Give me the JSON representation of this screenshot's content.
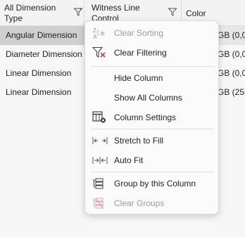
{
  "header": {
    "col1_label": "All Dimension Type",
    "col2_label": "Witness Line Control",
    "col3_label": "Color"
  },
  "rows": [
    {
      "type": "Angular Dimension",
      "color": "GB (0,0,"
    },
    {
      "type": "Diameter Dimension",
      "color": "GB (0,0,"
    },
    {
      "type": "Linear Dimension",
      "color": "GB (0,0,"
    },
    {
      "type": "Linear Dimension",
      "color": "GB (255"
    }
  ],
  "menu": {
    "clear_sorting": "Clear Sorting",
    "clear_filtering": "Clear Filtering",
    "hide_column": "Hide Column",
    "show_all_columns": "Show All Columns",
    "column_settings": "Column Settings",
    "stretch_to_fill": "Stretch to Fill",
    "auto_fit": "Auto Fit",
    "group_by_column": "Group by this Column",
    "clear_groups": "Clear Groups"
  },
  "icons": {
    "clear_sorting": "sort-clear-icon",
    "clear_filtering": "filter-clear-icon",
    "column_settings": "column-settings-icon",
    "stretch_to_fill": "stretch-icon",
    "auto_fit": "autofit-icon",
    "group_by_column": "group-icon",
    "clear_groups": "clear-groups-icon"
  },
  "colors": {
    "accent_red": "#d9363e",
    "selected_row": "#cfcfcf"
  }
}
